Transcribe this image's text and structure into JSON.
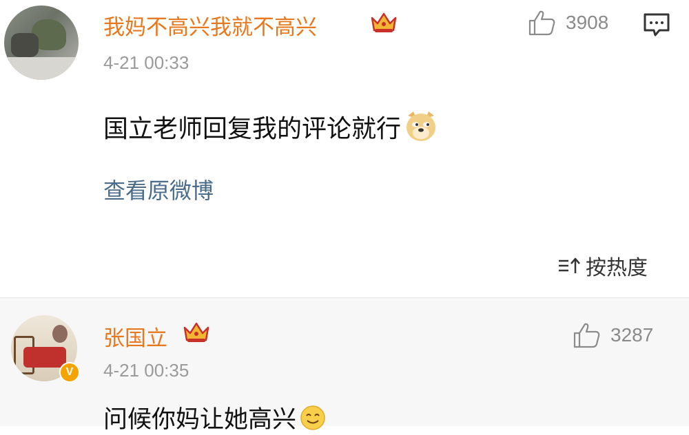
{
  "comment": {
    "username": "我妈不高兴我就不高兴",
    "timestamp": "4-21 00:33",
    "likes": "3908",
    "text": "国立老师回复我的评论就行",
    "emoji": "doge-emoji",
    "view_original_label": "查看原微博"
  },
  "sort": {
    "label": "按热度"
  },
  "reply": {
    "username": "张国立",
    "verified_badge": "V",
    "timestamp": "4-21 00:35",
    "likes": "3287",
    "text": "问候你妈让她高兴",
    "emoji": "smile-emoji"
  },
  "colors": {
    "username": "#e8781e",
    "link": "#4a6b8a",
    "meta": "#9a9a9a",
    "crown": "#f2b632",
    "verified": "#f5a300",
    "reply_bg": "#f7f7f7"
  },
  "icons": [
    "crown-icon",
    "thumbs-up-icon",
    "reply-comment-icon",
    "sort-icon",
    "doge-emoji",
    "smile-emoji",
    "verified-badge-icon"
  ]
}
